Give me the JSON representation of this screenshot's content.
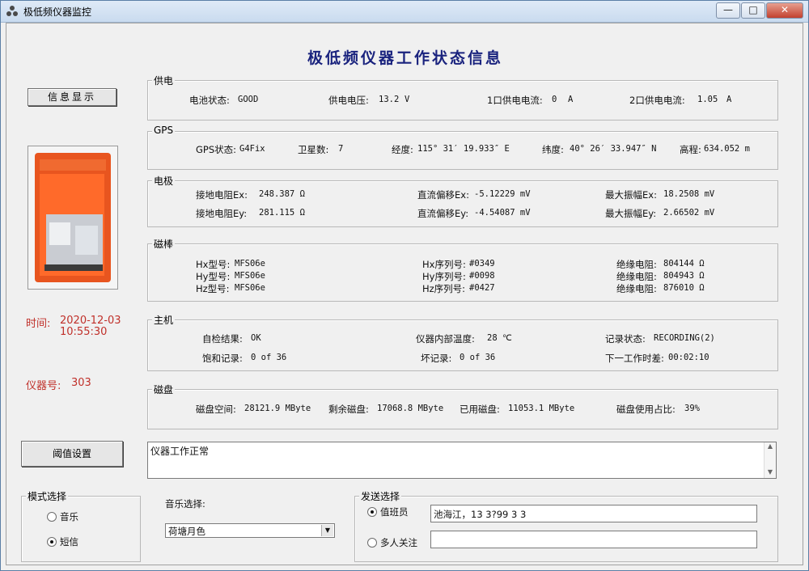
{
  "window": {
    "title": "极低频仪器监控",
    "buttons": {
      "minimize": "—",
      "maximize": "□",
      "close": "✕"
    }
  },
  "header": {
    "title": "极低频仪器工作状态信息"
  },
  "left": {
    "info_button": "信息显示",
    "time_label": "时间:",
    "date": "2020-12-03",
    "time": "10:55:30",
    "instrument_label": "仪器号:",
    "instrument_id": "303",
    "threshold_button": "阈值设置"
  },
  "power": {
    "title": "供电",
    "battery_label": "电池状态:",
    "battery": "GOOD",
    "voltage_label": "供电电压:",
    "voltage": "13.2",
    "voltage_unit": "V",
    "port1_label": "1口供电电流:",
    "port1": "0",
    "port1_unit": "A",
    "port2_label": "2口供电电流:",
    "port2": "1.05",
    "port2_unit": "A"
  },
  "gps": {
    "title": "GPS",
    "status_label": "GPS状态:",
    "status": "G4Fix",
    "sats_label": "卫星数:",
    "sats": "7",
    "lon_label": "经度:",
    "lon": "115° 31′ 19.933″ E",
    "lat_label": "纬度:",
    "lat": "40° 26′ 33.947″ N",
    "alt_label": "高程:",
    "alt": "634.052 m"
  },
  "electrode": {
    "title": "电极",
    "rows": [
      {
        "ground_label": "接地电阻Ex:",
        "ground": "248.387 Ω",
        "offset_label": "直流偏移Ex:",
        "offset": "-5.12229 mV",
        "amp_label": "最大振幅Ex:",
        "amp": "18.2508 mV"
      },
      {
        "ground_label": "接地电阻Ey:",
        "ground": "281.115 Ω",
        "offset_label": "直流偏移Ey:",
        "offset": "-4.54087 mV",
        "amp_label": "最大振幅Ey:",
        "amp": "2.66502 mV"
      }
    ]
  },
  "magnet": {
    "title": "磁棒",
    "rows": [
      {
        "model_label": "Hx型号:",
        "model": "MFS06e",
        "serial_label": "Hx序列号:",
        "serial": "#0349",
        "ins_label": "绝缘电阻:",
        "ins": "804144  Ω"
      },
      {
        "model_label": "Hy型号:",
        "model": "MFS06e",
        "serial_label": "Hy序列号:",
        "serial": "#0098",
        "ins_label": "绝缘电阻:",
        "ins": "804943  Ω"
      },
      {
        "model_label": "Hz型号:",
        "model": "MFS06e",
        "serial_label": "Hz序列号:",
        "serial": "#0427",
        "ins_label": "绝缘电阻:",
        "ins": "876010  Ω"
      }
    ]
  },
  "host": {
    "title": "主机",
    "self_label": "自检结果:",
    "self": "OK",
    "temp_label": "仪器内部温度:",
    "temp": "28 ℃",
    "rec_label": "记录状态:",
    "rec": "RECORDING(2)",
    "sat_label": "饱和记录:",
    "sat": "0 of 36",
    "bad_label": "坏记录:",
    "bad": "0 of 36",
    "next_label": "下一工作时差:",
    "next": "00:02:10"
  },
  "disk": {
    "title": "磁盘",
    "space_label": "磁盘空间:",
    "space": "28121.9 MByte",
    "free_label": "剩余磁盘:",
    "free": "17068.8 MByte",
    "used_label": "已用磁盘:",
    "used": "11053.1 MByte",
    "ratio_label": "磁盘使用占比:",
    "ratio": "39%"
  },
  "status_text": "仪器工作正常",
  "mode": {
    "title": "模式选择",
    "opt1": "音乐",
    "opt2": "短信",
    "selected": "短信"
  },
  "music": {
    "label": "音乐选择:",
    "value": "荷塘月色"
  },
  "send": {
    "title": "发送选择",
    "opt1": "值班员",
    "opt1_value": "池海江，13  3?99 3 3",
    "opt2": "多人关注",
    "opt2_value": ""
  }
}
